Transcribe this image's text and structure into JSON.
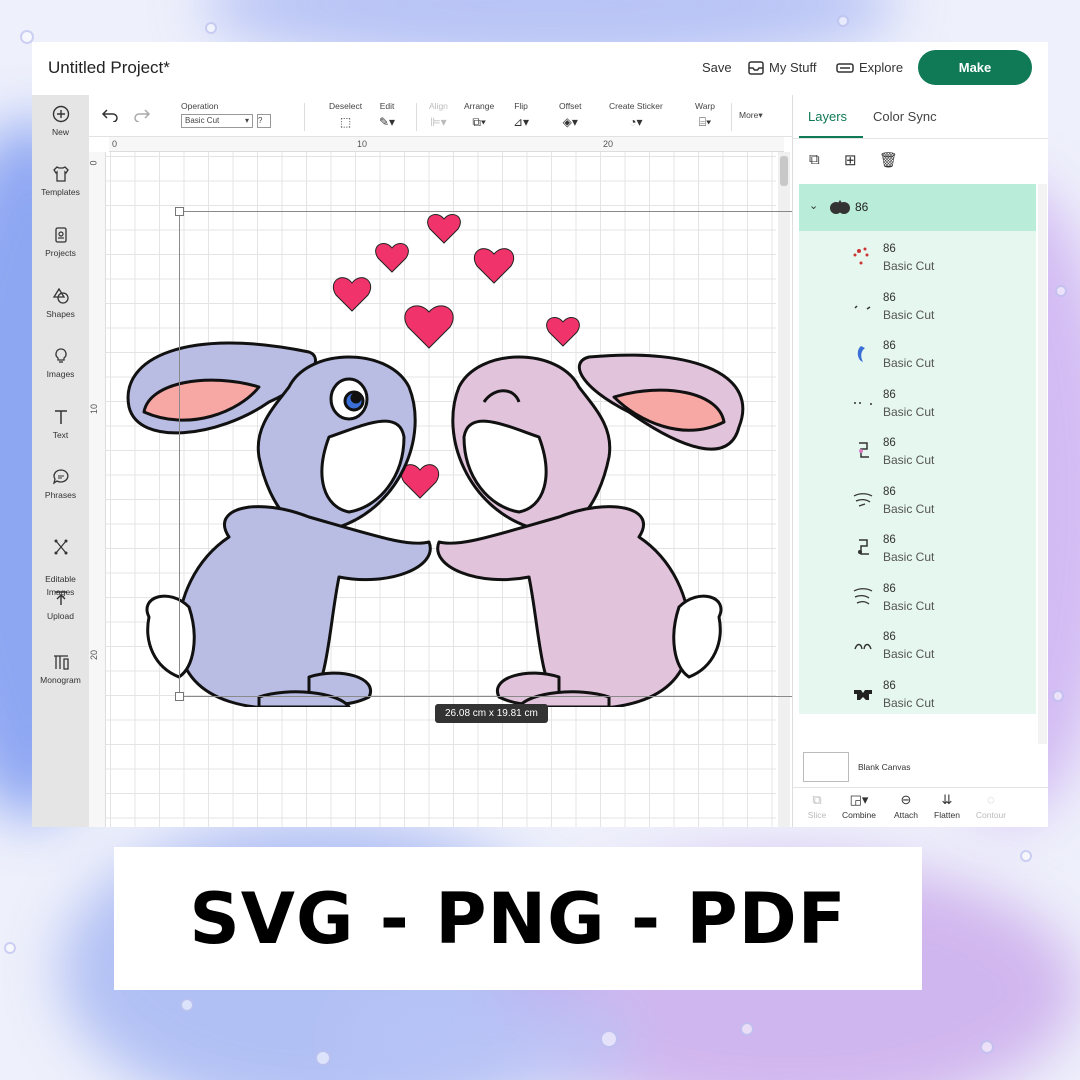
{
  "header": {
    "project_title": "Untitled Project*",
    "save_label": "Save",
    "my_stuff_label": "My Stuff",
    "explore_label": "Explore",
    "make_label": "Make"
  },
  "rail": {
    "items": [
      {
        "label": "New",
        "icon": "plus-circle-icon"
      },
      {
        "label": "Templates",
        "icon": "shirt-icon"
      },
      {
        "label": "Projects",
        "icon": "projects-icon"
      },
      {
        "label": "Shapes",
        "icon": "shapes-icon"
      },
      {
        "label": "Images",
        "icon": "bulb-icon"
      },
      {
        "label": "Text",
        "icon": "text-icon"
      },
      {
        "label": "Phrases",
        "icon": "speech-bubble-icon"
      },
      {
        "label": "Editable\nImages",
        "icon": "editable-images-icon"
      },
      {
        "label": "Upload",
        "icon": "upload-icon"
      },
      {
        "label": "Monogram",
        "icon": "monogram-icon"
      }
    ]
  },
  "toolbar": {
    "operation_label": "Operation",
    "operation_value": "Basic Cut",
    "help_label": "?",
    "deselect_label": "Deselect",
    "edit_label": "Edit",
    "align_label": "Align",
    "arrange_label": "Arrange",
    "flip_label": "Flip",
    "offset_label": "Offset",
    "create_sticker_label": "Create Sticker",
    "warp_label": "Warp",
    "more_label": "More"
  },
  "canvas": {
    "ruler_top": [
      "0",
      "10",
      "20"
    ],
    "ruler_left": [
      "0",
      "10",
      "20"
    ],
    "dimension_text": "26.08  cm x 19.81  cm"
  },
  "panel": {
    "tabs": [
      "Layers",
      "Color Sync"
    ],
    "group_name": "86",
    "layers": [
      {
        "name": "86",
        "operation": "Basic Cut"
      },
      {
        "name": "86",
        "operation": "Basic Cut"
      },
      {
        "name": "86",
        "operation": "Basic Cut"
      },
      {
        "name": "86",
        "operation": "Basic Cut"
      },
      {
        "name": "86",
        "operation": "Basic Cut"
      },
      {
        "name": "86",
        "operation": "Basic Cut"
      },
      {
        "name": "86",
        "operation": "Basic Cut"
      },
      {
        "name": "86",
        "operation": "Basic Cut"
      },
      {
        "name": "86",
        "operation": "Basic Cut"
      },
      {
        "name": "86",
        "operation": "Basic Cut"
      }
    ],
    "blank_canvas_label": "Blank Canvas",
    "bottom_tools": [
      {
        "label": "Slice",
        "enabled": false
      },
      {
        "label": "Combine",
        "enabled": true
      },
      {
        "label": "Attach",
        "enabled": true
      },
      {
        "label": "Flatten",
        "enabled": true
      },
      {
        "label": "Contour",
        "enabled": false
      }
    ]
  },
  "banner": {
    "text": "SVG - PNG - PDF"
  },
  "colors": {
    "accent": "#0f7a55",
    "layer_group_bg": "#b9ecd9",
    "layers_bg": "#e6f7ef",
    "bunny_left": "#b9bde3",
    "bunny_right": "#e2c3dc",
    "heart": "#f0336a"
  }
}
